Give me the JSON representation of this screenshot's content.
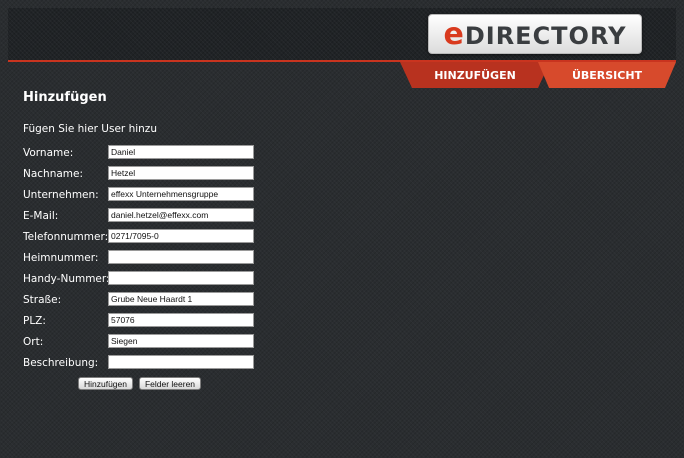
{
  "header": {
    "logo": {
      "prefix": "e",
      "rest": "DIRECTORY"
    },
    "tabs": [
      {
        "label": "HINZUFÜGEN",
        "active": true
      },
      {
        "label": "ÜBERSICHT",
        "active": false
      }
    ],
    "accent_color": "#c9341f"
  },
  "main": {
    "title": "Hinzufügen",
    "subtitle": "Fügen Sie hier User hinzu",
    "form": {
      "fields": [
        {
          "label": "Vorname:",
          "value": "Daniel"
        },
        {
          "label": "Nachname:",
          "value": "Hetzel"
        },
        {
          "label": "Unternehmen:",
          "value": "effexx Unternehmensgruppe"
        },
        {
          "label": "E-Mail:",
          "value": "daniel.hetzel@effexx.com"
        },
        {
          "label": "Telefonnummer:",
          "value": "0271/7095-0"
        },
        {
          "label": "Heimnummer:",
          "value": ""
        },
        {
          "label": "Handy-Nummer:",
          "value": ""
        },
        {
          "label": "Straße:",
          "value": "Grube Neue Haardt 1"
        },
        {
          "label": "PLZ:",
          "value": "57076"
        },
        {
          "label": "Ort:",
          "value": "Siegen"
        },
        {
          "label": "Beschreibung:",
          "value": ""
        }
      ],
      "buttons": {
        "submit": "Hinzufügen",
        "reset": "Felder leeren"
      }
    }
  }
}
